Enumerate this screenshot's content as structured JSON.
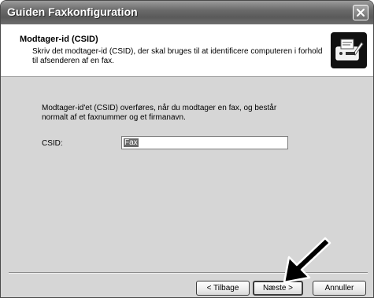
{
  "window": {
    "title": "Guiden Faxkonfiguration"
  },
  "header": {
    "title": "Modtager-id (CSID)",
    "description": "Skriv det modtager-id (CSID), der skal bruges til at identificere computeren i forhold til afsenderen af en fax.",
    "icon": "fax-wizard-icon"
  },
  "main": {
    "info_text": "Modtager-id'et (CSID) overføres, når du modtager en fax, og består normalt af et faxnummer og et firmanavn.",
    "csid_label": "CSID:",
    "csid_value": "Fax"
  },
  "buttons": {
    "back": "< Tilbage",
    "next": "Næste >",
    "cancel": "Annuller"
  },
  "icons": {
    "close": "close-icon",
    "annotation": "pointer-arrow-icon"
  }
}
